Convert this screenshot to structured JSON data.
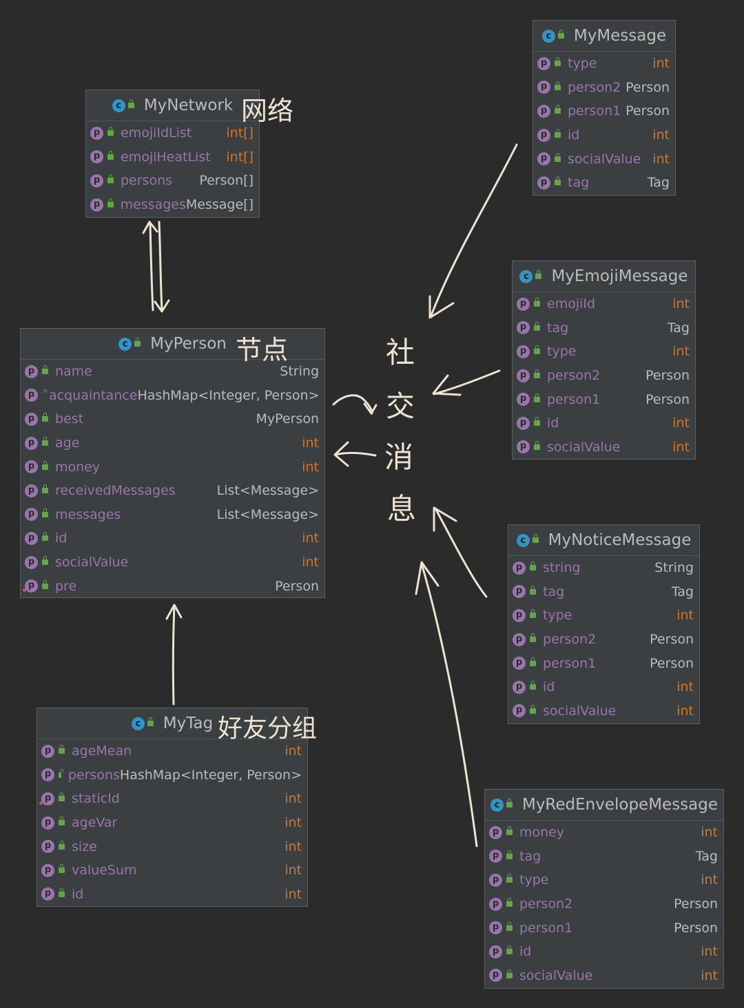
{
  "classes": {
    "mynetwork": {
      "name": "MyNetwork",
      "fields": [
        {
          "name": "emojiIdList",
          "type": "int[]",
          "kind": "int"
        },
        {
          "name": "emojiHeatList",
          "type": "int[]",
          "kind": "int"
        },
        {
          "name": "persons",
          "type": "Person[]",
          "kind": "ref"
        },
        {
          "name": "messages",
          "type": "Message[]",
          "kind": "ref"
        }
      ]
    },
    "myperson": {
      "name": "MyPerson",
      "fields": [
        {
          "name": "name",
          "type": "String",
          "kind": "ref"
        },
        {
          "name": "acquaintance",
          "type": "HashMap<Integer, Person>",
          "kind": "ref"
        },
        {
          "name": "best",
          "type": "MyPerson",
          "kind": "ref"
        },
        {
          "name": "age",
          "type": "int",
          "kind": "int"
        },
        {
          "name": "money",
          "type": "int",
          "kind": "int"
        },
        {
          "name": "receivedMessages",
          "type": "List<Message>",
          "kind": "ref"
        },
        {
          "name": "messages",
          "type": "List<Message>",
          "kind": "ref"
        },
        {
          "name": "id",
          "type": "int",
          "kind": "int"
        },
        {
          "name": "socialValue",
          "type": "int",
          "kind": "int"
        },
        {
          "name": "pre",
          "type": "Person",
          "kind": "ref"
        }
      ]
    },
    "mytag": {
      "name": "MyTag",
      "fields": [
        {
          "name": "ageMean",
          "type": "int",
          "kind": "int"
        },
        {
          "name": "persons",
          "type": "HashMap<Integer, Person>",
          "kind": "ref"
        },
        {
          "name": "staticId",
          "type": "int",
          "kind": "int"
        },
        {
          "name": "ageVar",
          "type": "int",
          "kind": "int"
        },
        {
          "name": "size",
          "type": "int",
          "kind": "int"
        },
        {
          "name": "valueSum",
          "type": "int",
          "kind": "int"
        },
        {
          "name": "id",
          "type": "int",
          "kind": "int"
        }
      ]
    },
    "mymessage": {
      "name": "MyMessage",
      "fields": [
        {
          "name": "type",
          "type": "int",
          "kind": "int"
        },
        {
          "name": "person2",
          "type": "Person",
          "kind": "ref"
        },
        {
          "name": "person1",
          "type": "Person",
          "kind": "ref"
        },
        {
          "name": "id",
          "type": "int",
          "kind": "int"
        },
        {
          "name": "socialValue",
          "type": "int",
          "kind": "int"
        },
        {
          "name": "tag",
          "type": "Tag",
          "kind": "ref"
        }
      ]
    },
    "myemojimessage": {
      "name": "MyEmojiMessage",
      "fields": [
        {
          "name": "emojiId",
          "type": "int",
          "kind": "int"
        },
        {
          "name": "tag",
          "type": "Tag",
          "kind": "ref"
        },
        {
          "name": "type",
          "type": "int",
          "kind": "int"
        },
        {
          "name": "person2",
          "type": "Person",
          "kind": "ref"
        },
        {
          "name": "person1",
          "type": "Person",
          "kind": "ref"
        },
        {
          "name": "id",
          "type": "int",
          "kind": "int"
        },
        {
          "name": "socialValue",
          "type": "int",
          "kind": "int"
        }
      ]
    },
    "mynoticemessage": {
      "name": "MyNoticeMessage",
      "fields": [
        {
          "name": "string",
          "type": "String",
          "kind": "ref"
        },
        {
          "name": "tag",
          "type": "Tag",
          "kind": "ref"
        },
        {
          "name": "type",
          "type": "int",
          "kind": "int"
        },
        {
          "name": "person2",
          "type": "Person",
          "kind": "ref"
        },
        {
          "name": "person1",
          "type": "Person",
          "kind": "ref"
        },
        {
          "name": "id",
          "type": "int",
          "kind": "int"
        },
        {
          "name": "socialValue",
          "type": "int",
          "kind": "int"
        }
      ]
    },
    "myredenvelopemessage": {
      "name": "MyRedEnvelopeMessage",
      "fields": [
        {
          "name": "money",
          "type": "int",
          "kind": "int"
        },
        {
          "name": "tag",
          "type": "Tag",
          "kind": "ref"
        },
        {
          "name": "type",
          "type": "int",
          "kind": "int"
        },
        {
          "name": "person2",
          "type": "Person",
          "kind": "ref"
        },
        {
          "name": "person1",
          "type": "Person",
          "kind": "ref"
        },
        {
          "name": "id",
          "type": "int",
          "kind": "int"
        },
        {
          "name": "socialValue",
          "type": "int",
          "kind": "int"
        }
      ]
    }
  },
  "annotations": {
    "network": "网络",
    "node": "节点",
    "tag": "好友分组",
    "social_1": "社",
    "social_2": "交",
    "social_3": "消",
    "social_4": "息"
  },
  "icons": {
    "class": "class-icon",
    "field": "property-icon",
    "visibility": "lock-icon"
  },
  "colors": {
    "background": "#2b2b2b",
    "panel": "#3c3f41",
    "field_name": "#9876aa",
    "type_int": "#cc7832",
    "text": "#bbbbbb",
    "handwriting": "#ede3d2"
  }
}
